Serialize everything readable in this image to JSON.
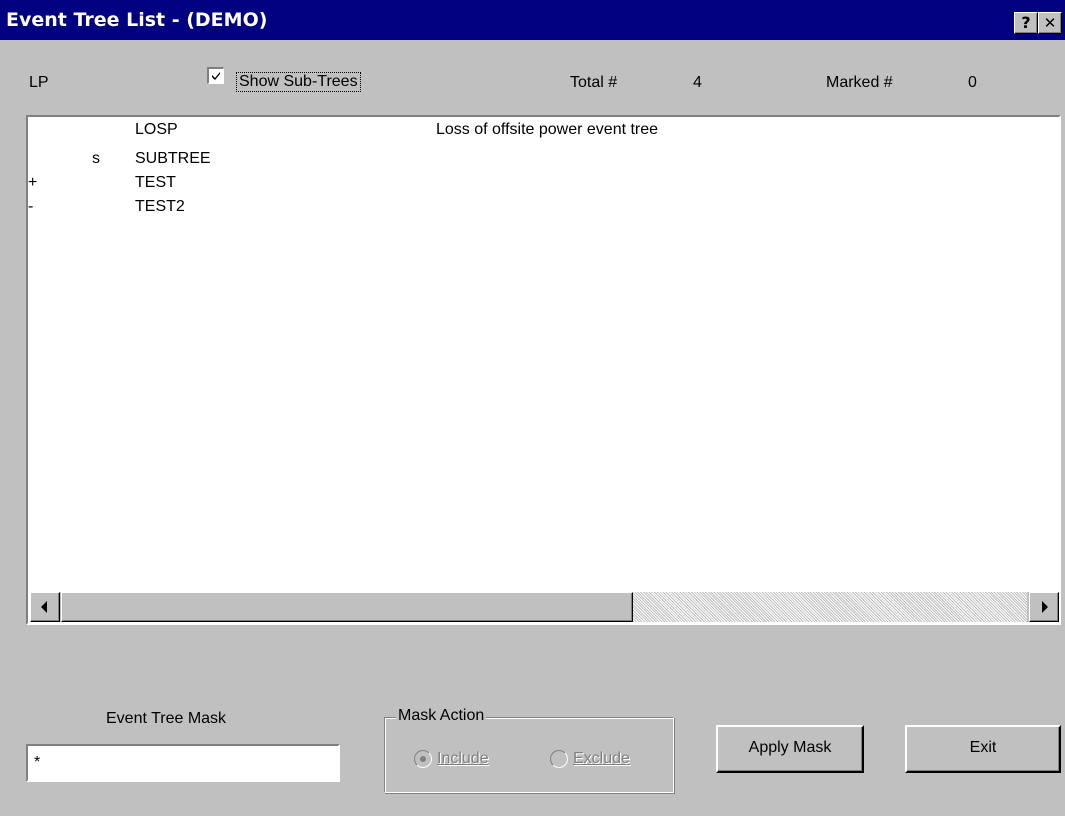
{
  "window": {
    "title": "Event Tree List  -  (DEMO)",
    "help_button": "?",
    "close_button": "✕"
  },
  "header": {
    "lp_label": "LP",
    "show_subtrees": {
      "label": "Show Sub-Trees",
      "checked": true
    },
    "total_label": "Total #",
    "total_value": "4",
    "marked_label": "Marked #",
    "marked_value": "0"
  },
  "list": {
    "rows": [
      {
        "marker": "",
        "flag": "",
        "name": "LOSP",
        "description": "Loss of offsite power event tree"
      },
      {
        "marker": "",
        "flag": "s",
        "name": "SUBTREE",
        "description": ""
      },
      {
        "marker": "+",
        "flag": "",
        "name": "TEST",
        "description": ""
      },
      {
        "marker": "-",
        "flag": "",
        "name": "TEST2",
        "description": ""
      }
    ]
  },
  "mask": {
    "label": "Event Tree Mask",
    "value": "*"
  },
  "mask_action": {
    "legend": "Mask Action",
    "include_label": "Include",
    "exclude_label": "Exclude",
    "selected": "Include",
    "enabled": false
  },
  "buttons": {
    "apply_mask": "Apply Mask",
    "exit": "Exit"
  },
  "icons": {
    "scroll_left": "left-arrow-icon",
    "scroll_right": "right-arrow-icon",
    "check": "checkmark-icon"
  }
}
